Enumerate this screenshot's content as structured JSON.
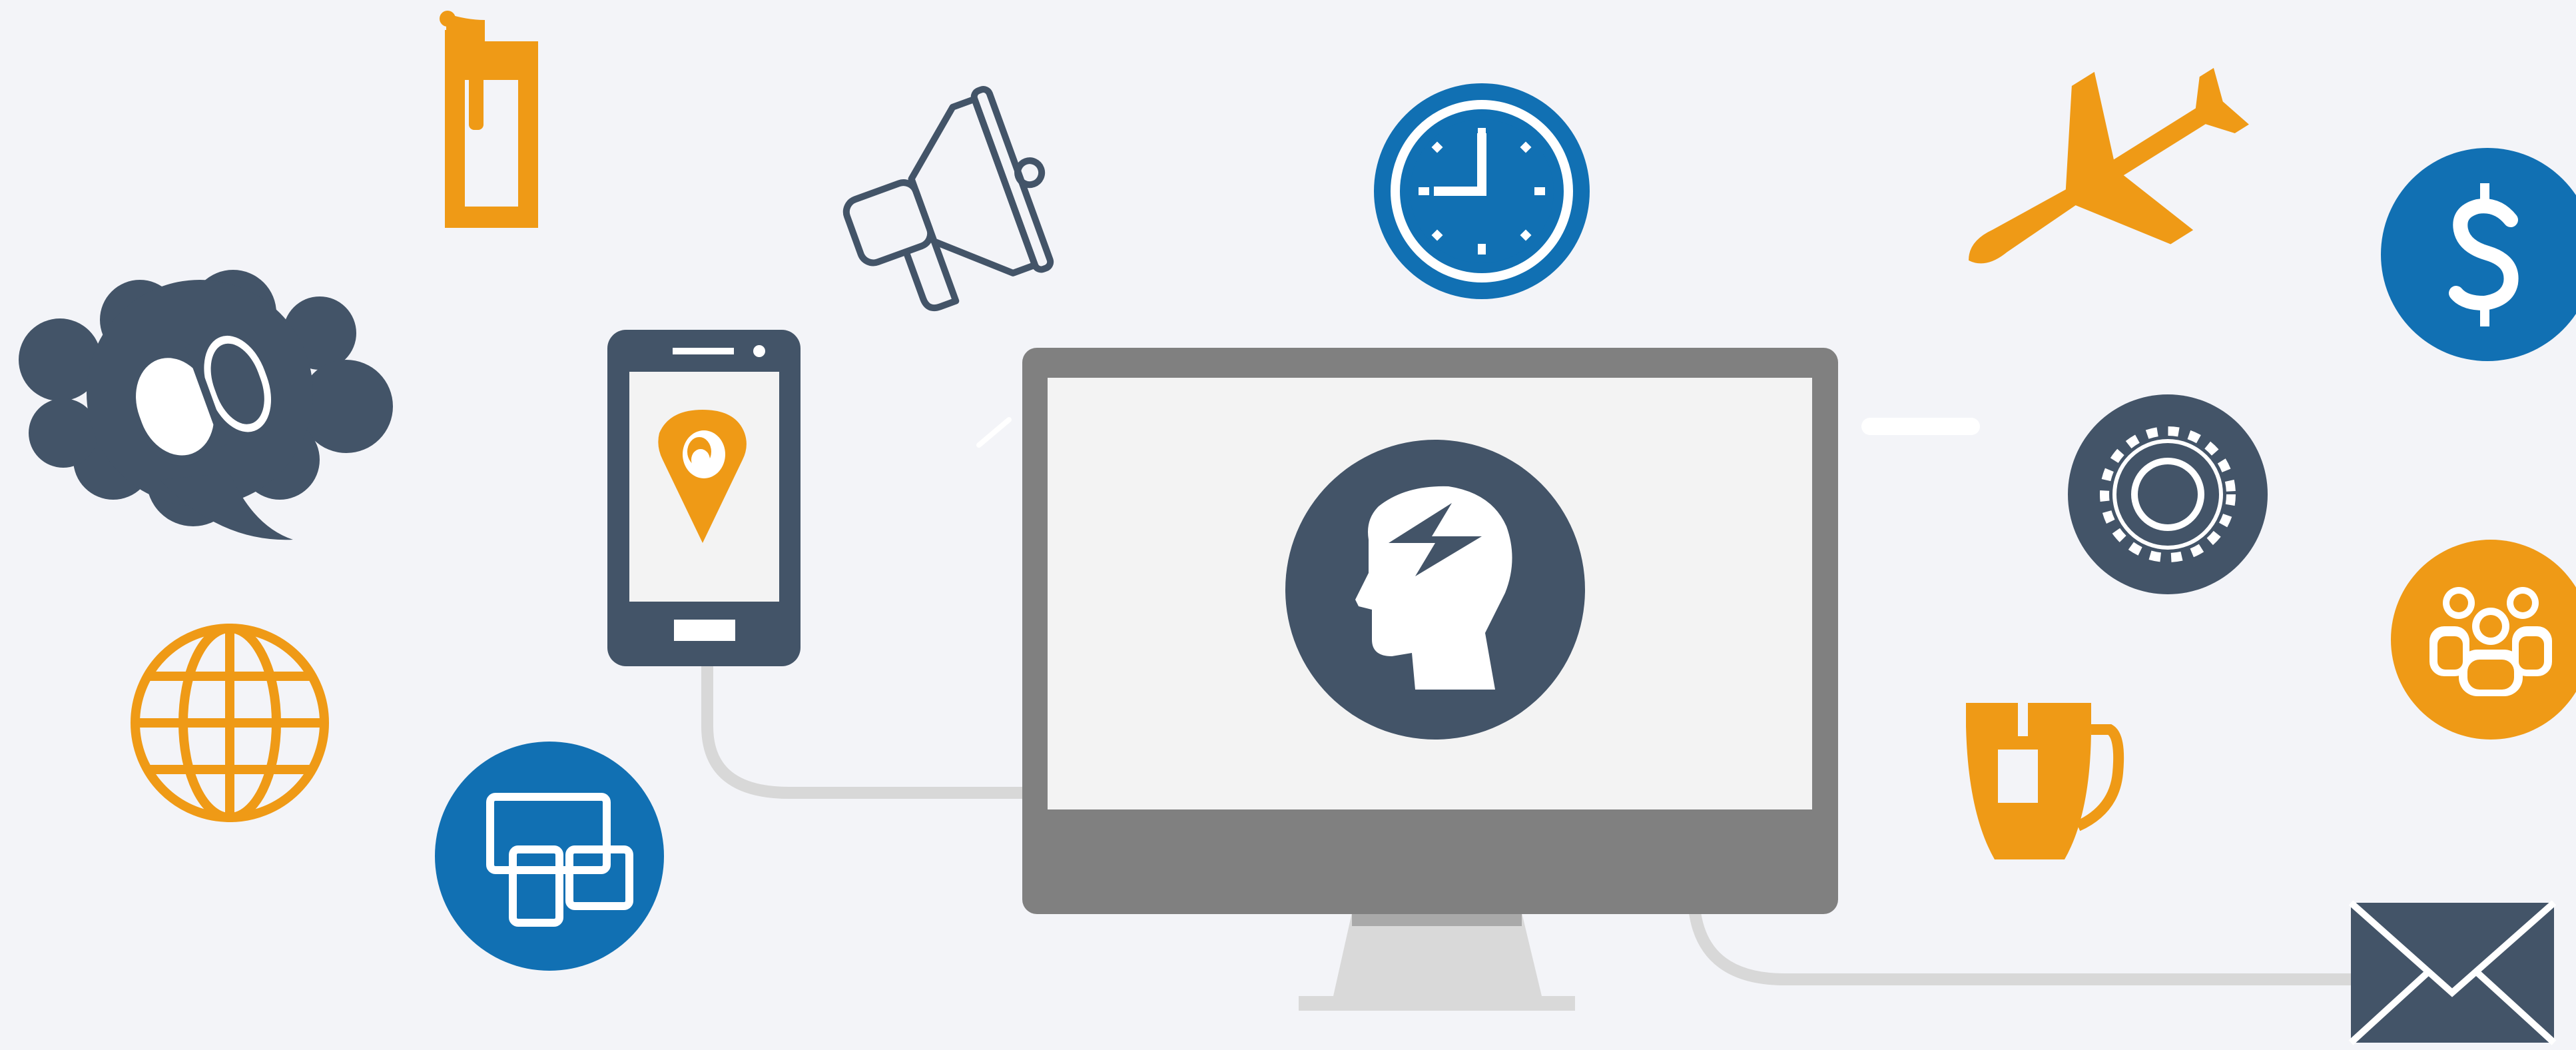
{
  "scene": {
    "description_free": true
  },
  "colors": {
    "background": "#f3f4f8",
    "navy": "#435468",
    "blue": "#1170b3",
    "orange": "#ef9a16",
    "monitor_gray": "#808080",
    "screen": "#f3f3f3",
    "stand": "#d9d9d9",
    "cable": "#d8d8d8",
    "white": "#ffffff"
  },
  "icons": [
    {
      "name": "monitor-icon"
    },
    {
      "name": "head-lightning-icon"
    },
    {
      "name": "smartphone-icon"
    },
    {
      "name": "map-pin-icon"
    },
    {
      "name": "speech-cloud-icon"
    },
    {
      "name": "pill-capsule-icon"
    },
    {
      "name": "megaphone-icon"
    },
    {
      "name": "clock-icon"
    },
    {
      "name": "airplane-icon"
    },
    {
      "name": "dollar-icon"
    },
    {
      "name": "gear-icon"
    },
    {
      "name": "group-users-icon"
    },
    {
      "name": "globe-icon"
    },
    {
      "name": "windows-devices-icon"
    },
    {
      "name": "coffee-mug-icon"
    },
    {
      "name": "envelope-icon"
    },
    {
      "name": "bucket-icon"
    }
  ]
}
